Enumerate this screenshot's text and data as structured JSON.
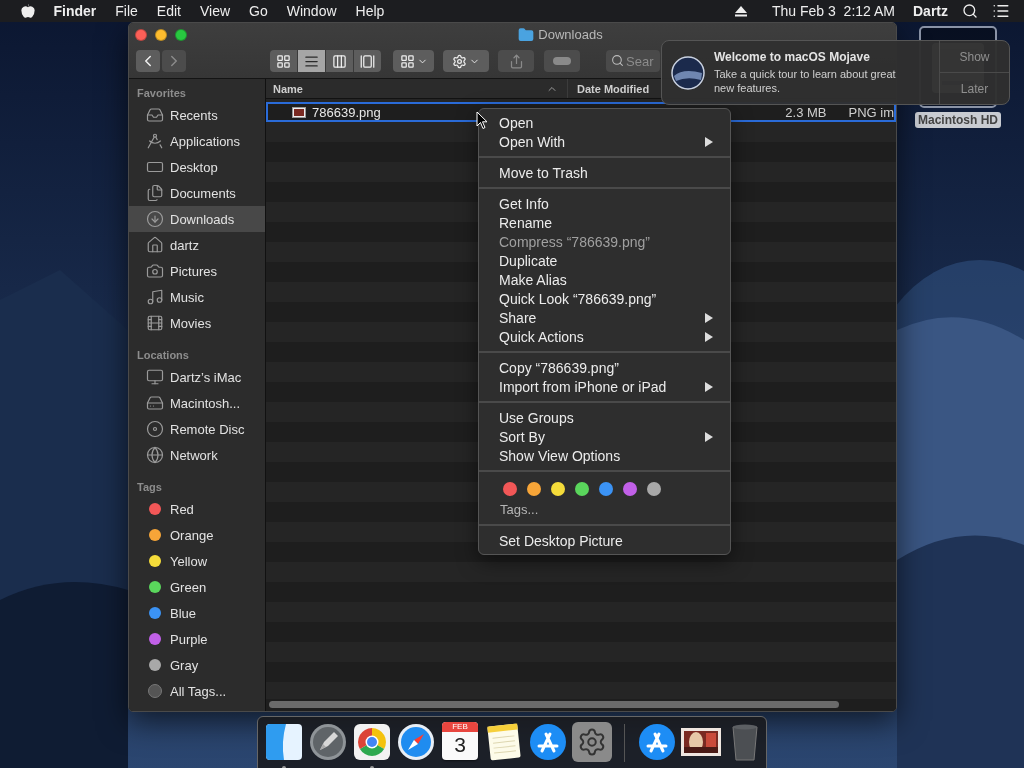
{
  "menu_bar": {
    "app_name": "Finder",
    "menus": [
      "File",
      "Edit",
      "View",
      "Go",
      "Window",
      "Help"
    ],
    "clock": "Thu Feb 3  2:12 AM",
    "user": "Dartz"
  },
  "window": {
    "title": "Downloads",
    "toolbar": {
      "buttons": [
        {
          "kind": "back",
          "disabled": false
        },
        {
          "kind": "forward",
          "disabled": true
        }
      ],
      "view_modes": [
        {
          "kind": "icons",
          "selected": false
        },
        {
          "kind": "list",
          "selected": true
        },
        {
          "kind": "columns",
          "selected": false
        },
        {
          "kind": "gallery",
          "selected": false
        }
      ],
      "tools": [
        {
          "kind": "group",
          "disabled": false
        },
        {
          "kind": "action",
          "disabled": false
        },
        {
          "kind": "share",
          "disabled": true
        },
        {
          "kind": "tags",
          "disabled": true
        }
      ],
      "search": {
        "placeholder": "Sear"
      }
    },
    "sidebar": {
      "sections": [
        {
          "heading": "Favorites",
          "items": [
            {
              "label": "Recents",
              "kind": "recents",
              "selected": false
            },
            {
              "label": "Applications",
              "kind": "applications",
              "selected": false
            },
            {
              "label": "Desktop",
              "kind": "desktop",
              "selected": false
            },
            {
              "label": "Documents",
              "kind": "documents",
              "selected": false
            },
            {
              "label": "Downloads",
              "kind": "downloads",
              "selected": true
            },
            {
              "label": "dartz",
              "kind": "home",
              "selected": false
            },
            {
              "label": "Pictures",
              "kind": "pictures",
              "selected": false
            },
            {
              "label": "Music",
              "kind": "music",
              "selected": false
            },
            {
              "label": "Movies",
              "kind": "movies",
              "selected": false
            }
          ]
        },
        {
          "heading": "Locations",
          "items": [
            {
              "label": "Dartz’s iMac",
              "kind": "computer",
              "selected": false
            },
            {
              "label": "Macintosh...",
              "kind": "disk",
              "selected": false
            },
            {
              "label": "Remote Disc",
              "kind": "disc",
              "selected": false
            },
            {
              "label": "Network",
              "kind": "network",
              "selected": false
            }
          ]
        },
        {
          "heading": "Tags",
          "items": [
            {
              "label": "Red",
              "kind": "tag",
              "color": "#f25757",
              "selected": false
            },
            {
              "label": "Orange",
              "kind": "tag",
              "color": "#f7a538",
              "selected": false
            },
            {
              "label": "Yellow",
              "kind": "tag",
              "color": "#f5dc3a",
              "selected": false
            },
            {
              "label": "Green",
              "kind": "tag",
              "color": "#5ad65c",
              "selected": false
            },
            {
              "label": "Blue",
              "kind": "tag",
              "color": "#3b93f5",
              "selected": false
            },
            {
              "label": "Purple",
              "kind": "tag",
              "color": "#c160e8",
              "selected": false
            },
            {
              "label": "Gray",
              "kind": "tag",
              "color": "#a8a8a8",
              "selected": false
            },
            {
              "label": "All Tags...",
              "kind": "all_tags",
              "selected": false
            }
          ]
        }
      ]
    },
    "file_list": {
      "columns": [
        "Name",
        "Date Modified"
      ],
      "rows": [
        {
          "name": "786639.png",
          "size": "2.3 MB",
          "file_kind": "PNG im",
          "selected": true
        }
      ]
    }
  },
  "context_menu": {
    "groups": [
      {
        "items": [
          {
            "label": "Open",
            "disabled": false,
            "submenu": false
          },
          {
            "label": "Open With",
            "disabled": false,
            "submenu": true
          }
        ]
      },
      {
        "items": [
          {
            "label": "Move to Trash",
            "disabled": false,
            "submenu": false
          }
        ]
      },
      {
        "items": [
          {
            "label": "Get Info",
            "disabled": false,
            "submenu": false
          },
          {
            "label": "Rename",
            "disabled": false,
            "submenu": false
          },
          {
            "label": "Compress “786639.png”",
            "disabled": true,
            "submenu": false
          },
          {
            "label": "Duplicate",
            "disabled": false,
            "submenu": false
          },
          {
            "label": "Make Alias",
            "disabled": false,
            "submenu": false
          },
          {
            "label": "Quick Look “786639.png”",
            "disabled": false,
            "submenu": false
          },
          {
            "label": "Share",
            "disabled": false,
            "submenu": true
          },
          {
            "label": "Quick Actions",
            "disabled": false,
            "submenu": true
          }
        ]
      },
      {
        "items": [
          {
            "label": "Copy “786639.png”",
            "disabled": false,
            "submenu": false
          },
          {
            "label": "Import from iPhone or iPad",
            "disabled": false,
            "submenu": true
          }
        ]
      },
      {
        "items": [
          {
            "label": "Use Groups",
            "disabled": false,
            "submenu": false
          },
          {
            "label": "Sort By",
            "disabled": false,
            "submenu": true
          },
          {
            "label": "Show View Options",
            "disabled": false,
            "submenu": false
          }
        ]
      }
    ],
    "tag_colors": [
      {
        "color": "#f25757"
      },
      {
        "color": "#f7a538"
      },
      {
        "color": "#f5dc3a"
      },
      {
        "color": "#5ad65c"
      },
      {
        "color": "#3b93f5"
      },
      {
        "color": "#c160e8"
      },
      {
        "color": "#a8a8a8"
      }
    ],
    "tags_label": "Tags...",
    "last_item": "Set Desktop Picture"
  },
  "notification": {
    "title": "Welcome to macOS Mojave",
    "body": "Take a quick tour to learn about great new features.",
    "actions": [
      "Show",
      "Later"
    ]
  },
  "desktop_icon": {
    "label": "Macintosh HD",
    "selected": true
  },
  "dock": {
    "items": [
      {
        "kind": "finder",
        "running": true
      },
      {
        "kind": "launchpad",
        "running": false
      },
      {
        "kind": "chrome",
        "running": true
      },
      {
        "kind": "safari",
        "running": false
      },
      {
        "kind": "calendar",
        "month": "FEB",
        "day": "3",
        "running": false
      },
      {
        "kind": "notes",
        "running": false
      },
      {
        "kind": "app_store",
        "running": false
      },
      {
        "kind": "system_preferences",
        "running": false
      },
      {
        "kind": "separator"
      },
      {
        "kind": "app_store",
        "running": false
      },
      {
        "kind": "picture",
        "running": false
      },
      {
        "kind": "trash",
        "running": false
      }
    ]
  }
}
